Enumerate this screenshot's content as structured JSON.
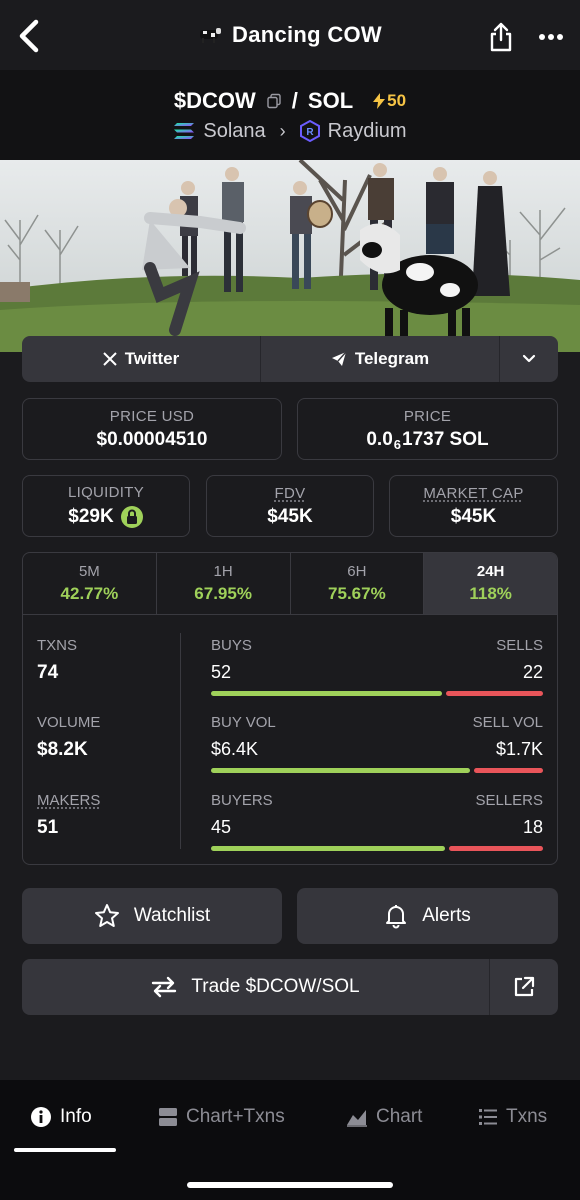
{
  "header": {
    "title": "Dancing COW",
    "back_icon": "chevron-left-icon",
    "share_icon": "share-icon",
    "more_icon": "more-dots-icon"
  },
  "pair": {
    "base": "$DCOW",
    "separator": "/",
    "quote": "SOL",
    "boost": "50",
    "chain": "Solana",
    "dex": "Raydium"
  },
  "socials": {
    "twitter": "Twitter",
    "telegram": "Telegram"
  },
  "stats": {
    "price_usd_label": "PRICE USD",
    "price_usd_value": "$0.00004510",
    "price_label": "PRICE",
    "price_prefix": "0.0",
    "price_zeros": "6",
    "price_digits": "1737 SOL",
    "liquidity_label": "LIQUIDITY",
    "liquidity_value": "$29K",
    "fdv_label": "FDV",
    "fdv_value": "$45K",
    "mcap_label": "MARKET CAP",
    "mcap_value": "$45K"
  },
  "timeframes": [
    {
      "label": "5M",
      "change": "42.77%"
    },
    {
      "label": "1H",
      "change": "67.95%"
    },
    {
      "label": "6H",
      "change": "75.67%"
    },
    {
      "label": "24H",
      "change": "118%"
    }
  ],
  "metrics": {
    "txns_label": "TXNS",
    "txns_value": "74",
    "volume_label": "VOLUME",
    "volume_value": "$8.2K",
    "makers_label": "MAKERS",
    "makers_value": "51",
    "buys_label": "BUYS",
    "buys_value": "52",
    "sells_label": "SELLS",
    "sells_value": "22",
    "buy_vol_label": "BUY VOL",
    "buy_vol_value": "$6.4K",
    "sell_vol_label": "SELL VOL",
    "sell_vol_value": "$1.7K",
    "buyers_label": "BUYERS",
    "buyers_value": "45",
    "sellers_label": "SELLERS",
    "sellers_value": "18"
  },
  "ratios": {
    "buys_fraction": 0.703,
    "buy_vol_fraction": 0.79,
    "buyers_fraction": 0.714
  },
  "actions": {
    "watchlist": "Watchlist",
    "alerts": "Alerts",
    "trade": "Trade $DCOW/SOL"
  },
  "nav": {
    "info": "Info",
    "chart_txns": "Chart+Txns",
    "chart": "Chart",
    "txns": "Txns"
  },
  "colors": {
    "green": "#9fd15a",
    "red": "#e9555a",
    "boost": "#f6c445"
  }
}
